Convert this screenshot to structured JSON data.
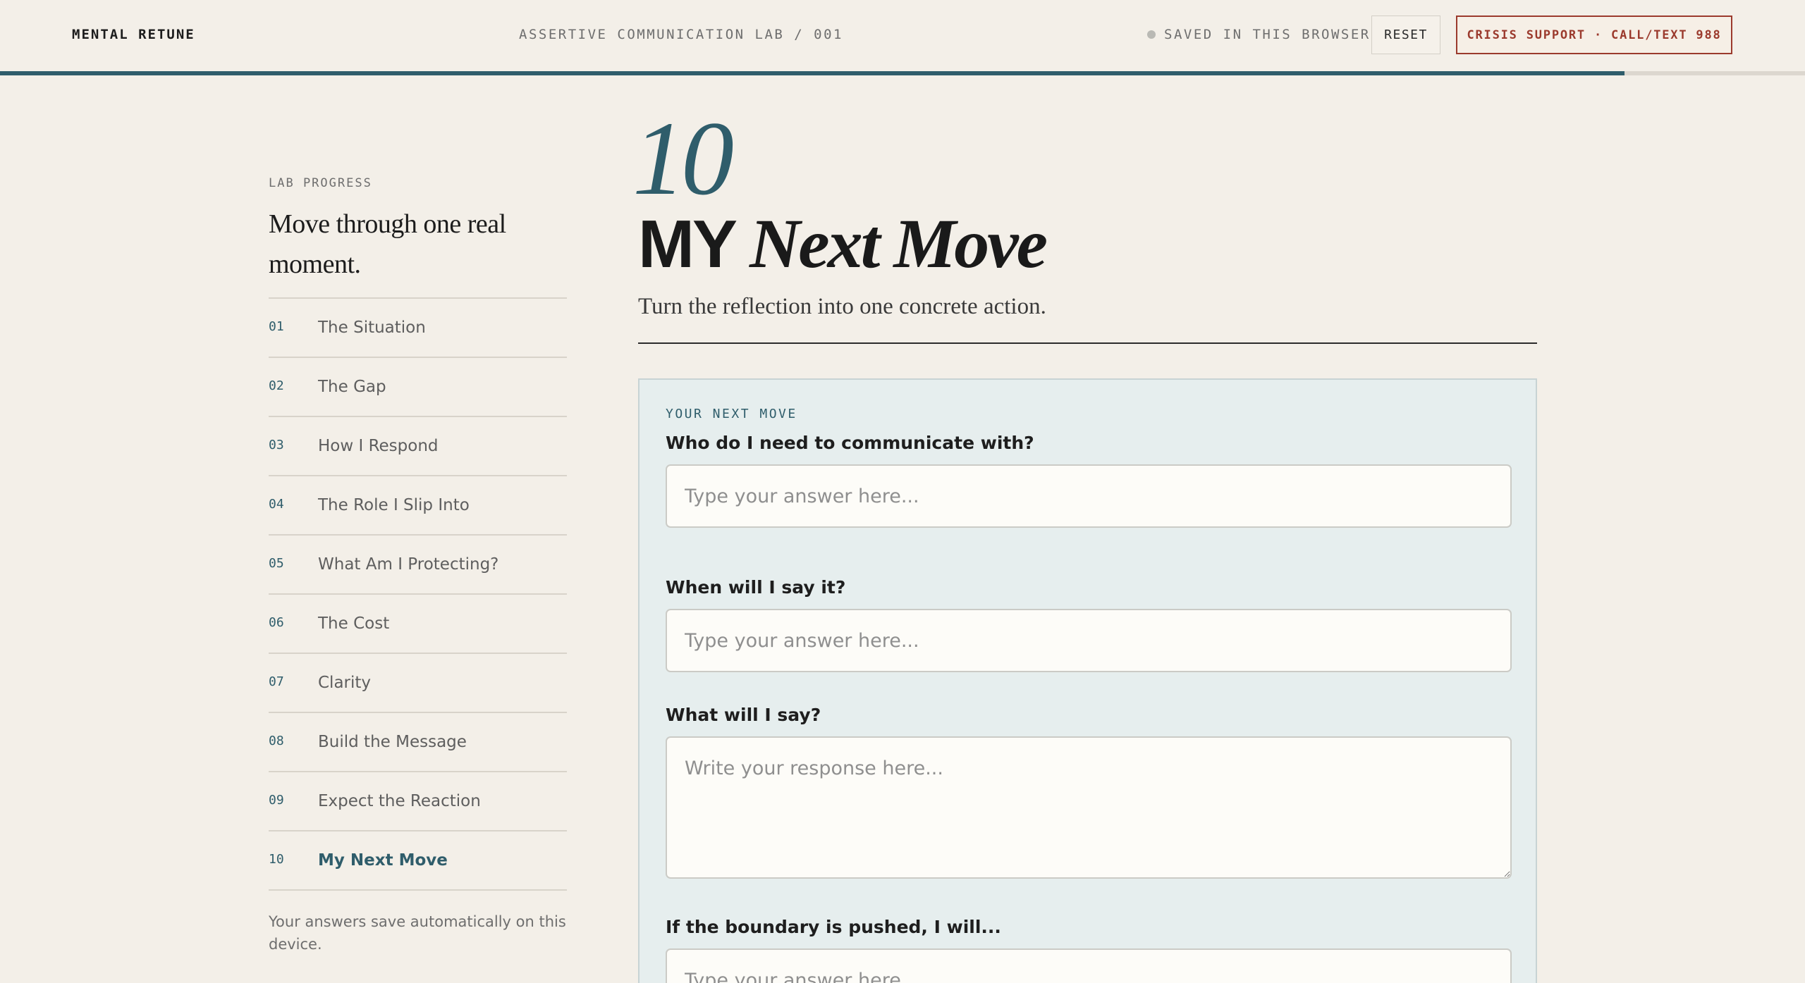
{
  "header": {
    "brand": "MENTAL RETUNE",
    "lab_title": "ASSERTIVE COMMUNICATION LAB / 001",
    "saved_status": "SAVED IN THIS BROWSER",
    "reset_label": "RESET",
    "crisis_label": "CRISIS SUPPORT · CALL/TEXT 988",
    "progress_fraction": 0.9
  },
  "sidebar": {
    "label": "LAB PROGRESS",
    "heading": "Move through one real moment.",
    "steps": [
      {
        "num": "01",
        "label": "The Situation"
      },
      {
        "num": "02",
        "label": "The Gap"
      },
      {
        "num": "03",
        "label": "How I Respond"
      },
      {
        "num": "04",
        "label": "The Role I Slip Into"
      },
      {
        "num": "05",
        "label": "What Am I Protecting?"
      },
      {
        "num": "06",
        "label": "The Cost"
      },
      {
        "num": "07",
        "label": "Clarity"
      },
      {
        "num": "08",
        "label": "Build the Message"
      },
      {
        "num": "09",
        "label": "Expect the Reaction"
      },
      {
        "num": "10",
        "label": "My Next Move"
      }
    ],
    "active_step": "10",
    "note": "Your answers save automatically on this device."
  },
  "main": {
    "step_number": "10",
    "title_bold": "MY",
    "title_italic": "Next Move",
    "subtitle": "Turn the reflection into one concrete action.",
    "card_label": "YOUR NEXT MOVE",
    "questions": [
      {
        "label": "Who do I need to communicate with?",
        "placeholder": "Type your answer here...",
        "value": ""
      },
      {
        "label": "When will I say it?",
        "placeholder": "Type your answer here...",
        "value": ""
      },
      {
        "label": "What will I say?",
        "placeholder": "Write your response here...",
        "value": ""
      },
      {
        "label": "If the boundary is pushed, I will...",
        "placeholder": "Type your answer here...",
        "value": ""
      }
    ]
  },
  "colors": {
    "accent": "#2f5d6b",
    "crisis": "#9b3a2d",
    "background": "#f3efe8",
    "card": "#e6eeee"
  }
}
